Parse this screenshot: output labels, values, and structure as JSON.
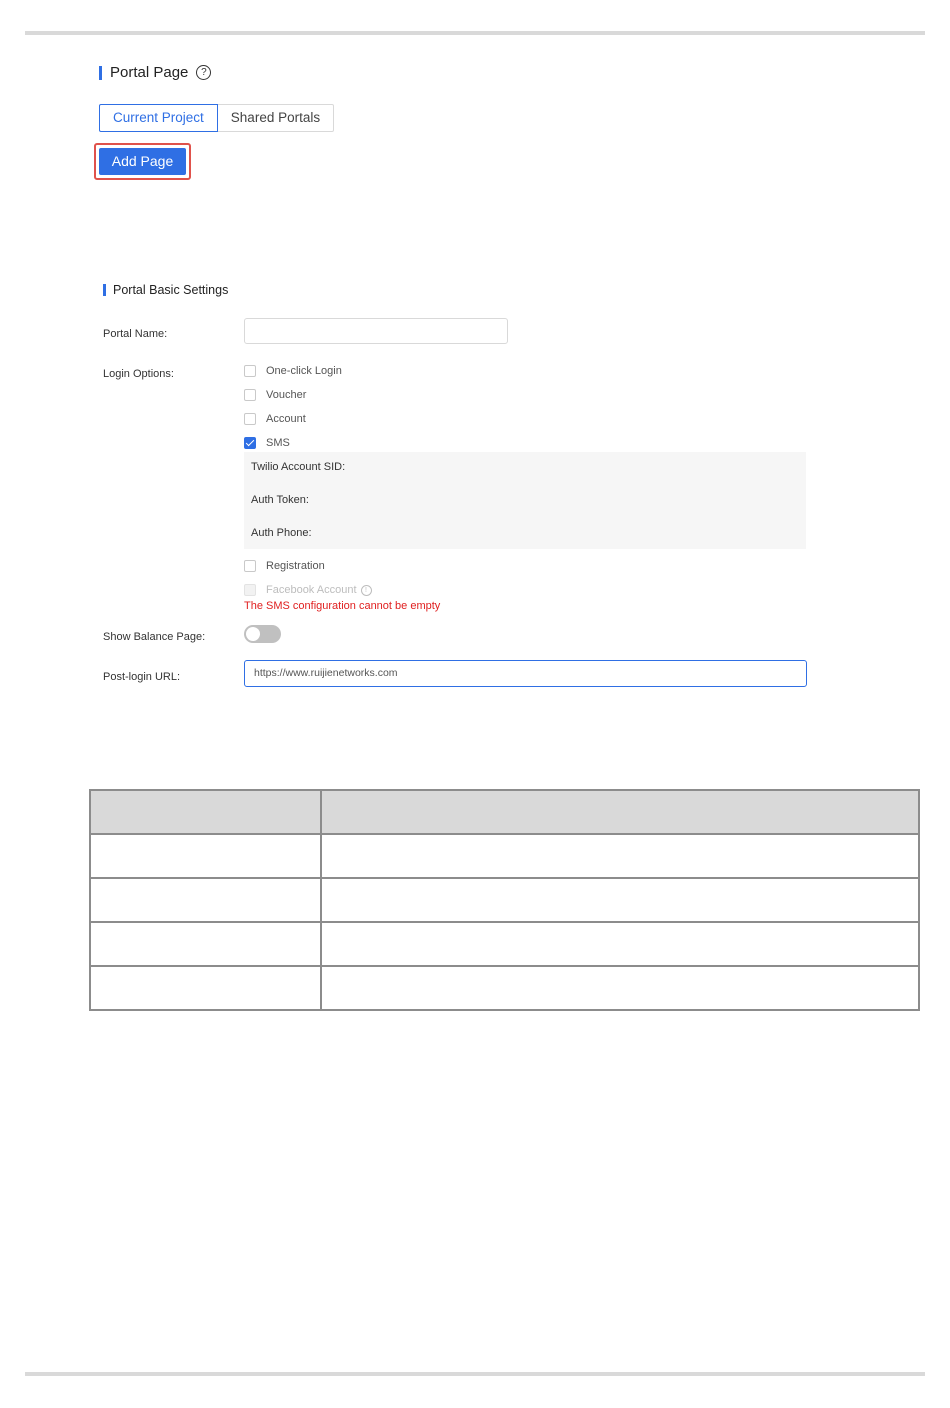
{
  "portal_page": {
    "title": "Portal Page",
    "help_icon": "?",
    "tabs": [
      {
        "label": "Current Project",
        "active": true
      },
      {
        "label": "Shared Portals",
        "active": false
      }
    ],
    "add_button": "Add Page"
  },
  "basic_settings": {
    "title": "Portal Basic Settings",
    "portal_name_label": "Portal Name:",
    "portal_name_value": "",
    "login_options_label": "Login Options:",
    "options": [
      {
        "label": "One-click Login",
        "checked": false,
        "disabled": false
      },
      {
        "label": "Voucher",
        "checked": false,
        "disabled": false
      },
      {
        "label": "Account",
        "checked": false,
        "disabled": false
      },
      {
        "label": "SMS",
        "checked": true,
        "disabled": false
      },
      {
        "label": "Registration",
        "checked": false,
        "disabled": false
      },
      {
        "label": "Facebook Account",
        "checked": false,
        "disabled": true
      }
    ],
    "sms_fields": [
      "Twilio Account SID:",
      "Auth Token:",
      "Auth Phone:"
    ],
    "info_icon": "!",
    "error_text": "The SMS configuration cannot be empty",
    "show_balance_label": "Show Balance Page:",
    "show_balance_on": false,
    "post_login_label": "Post-login URL:",
    "post_login_value": "https://www.ruijienetworks.com"
  },
  "colors": {
    "accent": "#2f6fe4",
    "highlight_border": "#e0524b",
    "error": "#e02020"
  }
}
